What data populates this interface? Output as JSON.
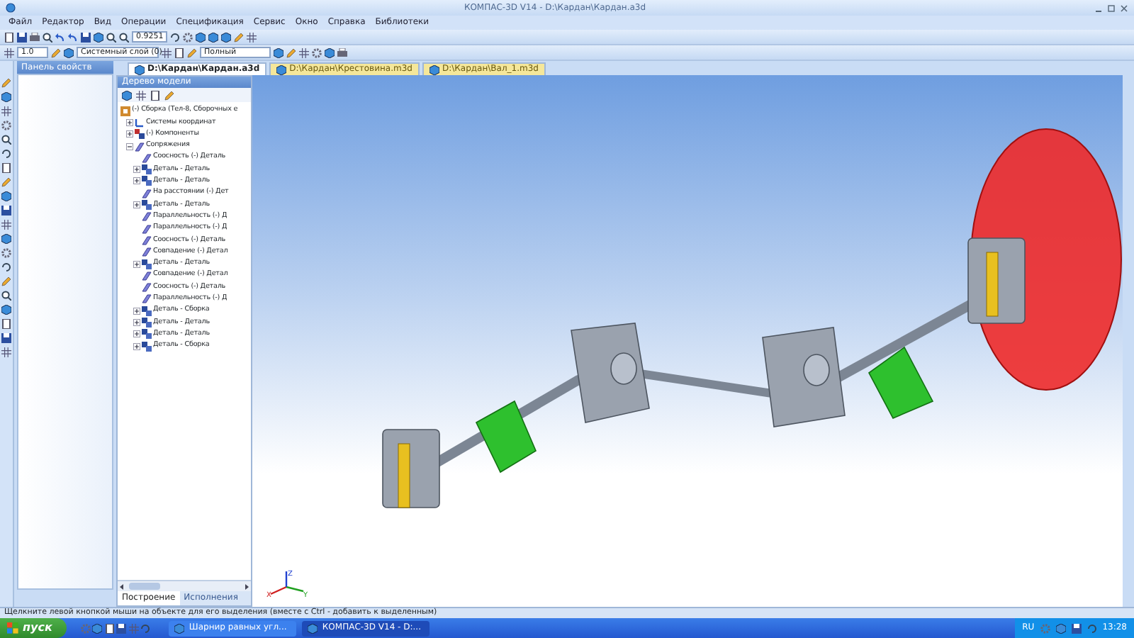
{
  "window": {
    "title": "КОМПАС-3D V14 - D:\\Кардан\\Кардан.a3d"
  },
  "menu": [
    "Файл",
    "Редактор",
    "Вид",
    "Операции",
    "Спецификация",
    "Сервис",
    "Окно",
    "Справка",
    "Библиотеки"
  ],
  "toolbar": {
    "scale": "0.9251",
    "step": "1.0",
    "layer": "Системный слой (0)",
    "view_mode": "Полный"
  },
  "property_panel": {
    "title": "Панель свойств"
  },
  "doc_tabs": [
    {
      "label": "D:\\Кардан\\Кардан.a3d",
      "selected": true
    },
    {
      "label": "D:\\Кардан\\Крестовина.m3d",
      "selected": false
    },
    {
      "label": "D:\\Кардан\\Вал_1.m3d",
      "selected": false
    }
  ],
  "model_tree": {
    "title": "Дерево модели",
    "root": {
      "label": "(-) Сборка (Тел-8, Сборочных е",
      "children": [
        {
          "label": "Системы координат",
          "kind": "axes",
          "expanded": false
        },
        {
          "label": "(-) Компоненты",
          "kind": "parts",
          "expanded": false
        },
        {
          "label": "Сопряжения",
          "kind": "mate",
          "expanded": true,
          "children": [
            {
              "label": "Соосность (-) Деталь",
              "kind": "mate"
            },
            {
              "label": "Деталь - Деталь",
              "kind": "pair",
              "expanded": false
            },
            {
              "label": "Деталь - Деталь",
              "kind": "pair",
              "expanded": false
            },
            {
              "label": "На расстоянии (-) Дет",
              "kind": "mate"
            },
            {
              "label": "Деталь - Деталь",
              "kind": "pair",
              "expanded": false
            },
            {
              "label": "Параллельность (-) Д",
              "kind": "mate"
            },
            {
              "label": "Параллельность (-) Д",
              "kind": "mate"
            },
            {
              "label": "Соосность (-) Деталь",
              "kind": "mate"
            },
            {
              "label": "Совпадение (-) Детал",
              "kind": "mate"
            },
            {
              "label": "Деталь - Деталь",
              "kind": "pair",
              "expanded": false
            },
            {
              "label": "Совпадение (-) Детал",
              "kind": "mate"
            },
            {
              "label": "Соосность (-) Деталь",
              "kind": "mate"
            },
            {
              "label": "Параллельность (-) Д",
              "kind": "mate"
            },
            {
              "label": "Деталь - Сборка",
              "kind": "pair",
              "expanded": false
            },
            {
              "label": "Деталь - Деталь",
              "kind": "pair",
              "expanded": false
            },
            {
              "label": "Деталь - Деталь",
              "kind": "pair",
              "expanded": false
            },
            {
              "label": "Деталь - Сборка",
              "kind": "pair",
              "expanded": false
            }
          ]
        }
      ]
    },
    "tabs": [
      {
        "label": "Построение",
        "selected": true
      },
      {
        "label": "Исполнения",
        "selected": false
      }
    ]
  },
  "viewport": {
    "axis_labels": [
      "X",
      "Y",
      "Z"
    ]
  },
  "status_bar": "Щелкните левой кнопкой мыши на объекте для его выделения (вместе с Ctrl - добавить к выделенным)",
  "taskbar": {
    "start": "пуск",
    "tasks": [
      {
        "label": "Шарнир равных угл...",
        "selected": false
      },
      {
        "label": "КОМПАС-3D V14 - D:...",
        "selected": true
      }
    ],
    "language": "RU",
    "clock": "13:28"
  }
}
